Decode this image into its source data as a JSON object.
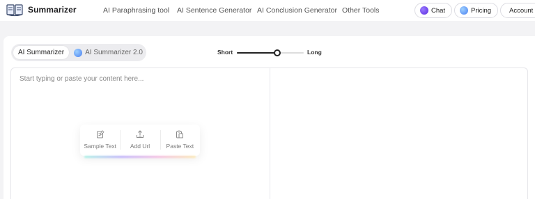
{
  "brand": {
    "name": "Summarizer",
    "logo_icon": "book-logo-icon"
  },
  "nav": {
    "links": [
      "AI Paraphrasing tool",
      "AI Sentence Generator",
      "AI Conclusion Generator",
      "Other Tools"
    ],
    "chat_label": "Chat",
    "pricing_label": "Pricing",
    "account_label": "Account"
  },
  "modes": {
    "active": "AI Summarizer",
    "v2": "AI Summarizer 2.0"
  },
  "length": {
    "short_label": "Short",
    "long_label": "Long",
    "value_fraction": 0.6
  },
  "editor": {
    "placeholder": "Start typing or paste your content here..."
  },
  "actions": [
    {
      "label": "Sample Text",
      "icon": "sample-text-icon"
    },
    {
      "label": "Add Url",
      "icon": "upload-icon"
    },
    {
      "label": "Paste Text",
      "icon": "clipboard-icon"
    }
  ],
  "colors": {
    "chat_dot": "#6b3df0",
    "pricing_dot": "#4a90f0",
    "summarizer2_dot": "#4a90f0",
    "slider_fill": "#222222"
  }
}
